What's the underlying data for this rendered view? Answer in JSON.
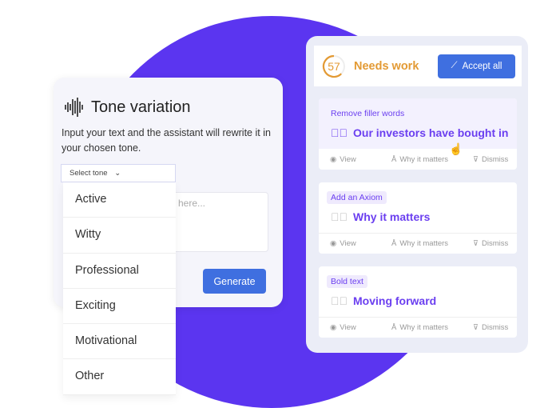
{
  "tone": {
    "title": "Tone variation",
    "description": "Input your text and the assistant will rewrite it in your chosen tone.",
    "select_label": "Select tone",
    "textarea_placeholder": "here...",
    "generate": "Generate",
    "options": [
      "Active",
      "Witty",
      "Professional",
      "Exciting",
      "Motivational",
      "Other"
    ]
  },
  "review": {
    "score": "57",
    "status": "Needs work",
    "accept_all": "Accept all",
    "cards": [
      {
        "tag": "Remove filler words",
        "text": "Our investors have bought in"
      },
      {
        "tag": "Add an Axiom",
        "text": "Why it matters"
      },
      {
        "tag": "Bold text",
        "text": "Moving forward"
      }
    ],
    "actions": {
      "view": "View",
      "why": "Why it matters",
      "dismiss": "Dismiss"
    }
  },
  "colors": {
    "accent": "#5b35f0",
    "primary": "#3f6fe0",
    "warning": "#e39a34",
    "suggestion": "#6b3ff0"
  }
}
